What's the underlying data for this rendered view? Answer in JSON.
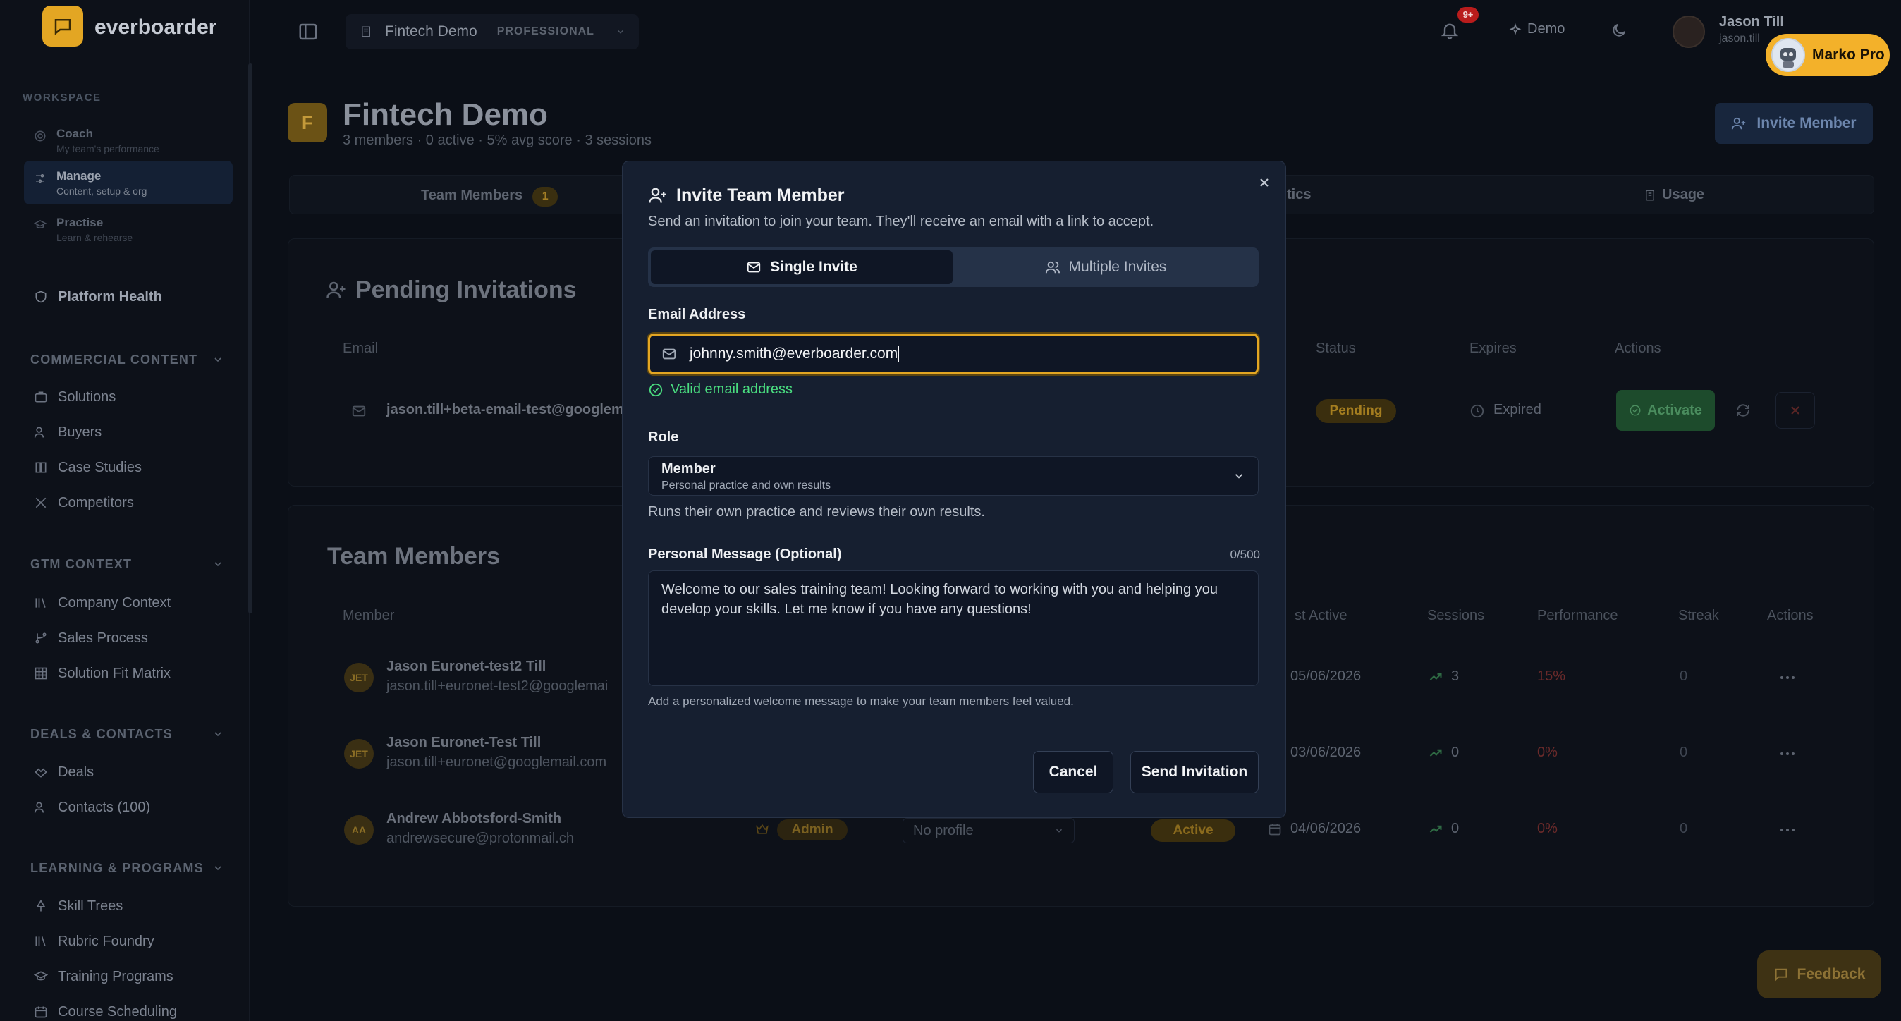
{
  "app": {
    "brand": "everboarder"
  },
  "sidebar": {
    "workspace_label": "WORKSPACE",
    "workspace": [
      {
        "title": "Coach",
        "subtitle": "My team's performance"
      },
      {
        "title": "Manage",
        "subtitle": "Content, setup & org"
      },
      {
        "title": "Practise",
        "subtitle": "Learn & rehearse"
      }
    ],
    "platform_health": "Platform Health",
    "sections": [
      {
        "label": "COMMERCIAL CONTENT",
        "items": [
          "Solutions",
          "Buyers",
          "Case Studies",
          "Competitors"
        ]
      },
      {
        "label": "GTM CONTEXT",
        "items": [
          "Company Context",
          "Sales Process",
          "Solution Fit Matrix"
        ]
      },
      {
        "label": "DEALS & CONTACTS",
        "items": [
          "Deals",
          "Contacts (100)"
        ]
      },
      {
        "label": "LEARNING & PROGRAMS",
        "items": [
          "Skill Trees",
          "Rubric Foundry",
          "Training Programs",
          "Course Scheduling"
        ]
      }
    ]
  },
  "topbar": {
    "tenant": "Fintech Demo",
    "plan": "PROFESSIONAL",
    "notif_badge": "9+",
    "demo": "Demo",
    "user_name": "Jason Till",
    "user_email": "jason.till",
    "assistant": "Marko Pro"
  },
  "page": {
    "icon_letter": "F",
    "title": "Fintech Demo",
    "subtitle": "3 members · 0 active · 5% avg score · 3 sessions",
    "invite_button": "Invite Member",
    "tabs": {
      "team": "Team Members",
      "team_count": "1",
      "analytics": "tics",
      "usage": "Usage"
    },
    "pending": {
      "title": "Pending Invitations",
      "headers": {
        "email": "Email",
        "status": "Status",
        "expires": "Expires",
        "actions": "Actions"
      },
      "row": {
        "email": "jason.till+beta-email-test@googlem",
        "status": "Pending",
        "expires": "Expired",
        "activate": "Activate"
      }
    },
    "members": {
      "title": "Team Members",
      "headers": {
        "member": "Member",
        "last_active": "st Active",
        "sessions": "Sessions",
        "performance": "Performance",
        "streak": "Streak",
        "actions": "Actions"
      },
      "rows": [
        {
          "initials": "JET",
          "name": "Jason Euronet-test2 Till",
          "email": "jason.till+euronet-test2@googlemai",
          "last_active": "05/06/2026",
          "sessions": "3",
          "performance": "15%",
          "streak": "0"
        },
        {
          "initials": "JET",
          "name": "Jason Euronet-Test Till",
          "email": "jason.till+euronet@googlemail.com",
          "last_active": "03/06/2026",
          "sessions": "0",
          "performance": "0%",
          "streak": "0"
        },
        {
          "initials": "AA",
          "name": "Andrew Abbotsford-Smith",
          "email": "andrewsecure@protonmail.ch",
          "role": "Admin",
          "profile": "No profile",
          "status": "Active",
          "last_active": "04/06/2026",
          "sessions": "0",
          "performance": "0%",
          "streak": "0"
        }
      ]
    },
    "feedback": "Feedback"
  },
  "modal": {
    "title": "Invite Team Member",
    "description": "Send an invitation to join your team. They'll receive an email with a link to accept.",
    "single_tab": "Single Invite",
    "multiple_tab": "Multiple Invites",
    "email_label": "Email Address",
    "email_value": "johnny.smith@everboarder.com",
    "valid_text": "Valid email address",
    "role_label": "Role",
    "role_value": "Member",
    "role_sub": "Personal practice and own results",
    "role_desc": "Runs their own practice and reviews their own results.",
    "message_label": "Personal Message (Optional)",
    "message_count": "0/500",
    "message_placeholder": "Welcome to our sales training team! Looking forward to working with you and helping you develop your skills. Let me know if you have any questions!",
    "hint": "Add a personalized welcome message to make your team members feel valued.",
    "cancel": "Cancel",
    "send": "Send Invitation"
  },
  "colors": {
    "accent": "#e3a623",
    "valid": "#4ade80",
    "modal_bg": "#161f30"
  }
}
